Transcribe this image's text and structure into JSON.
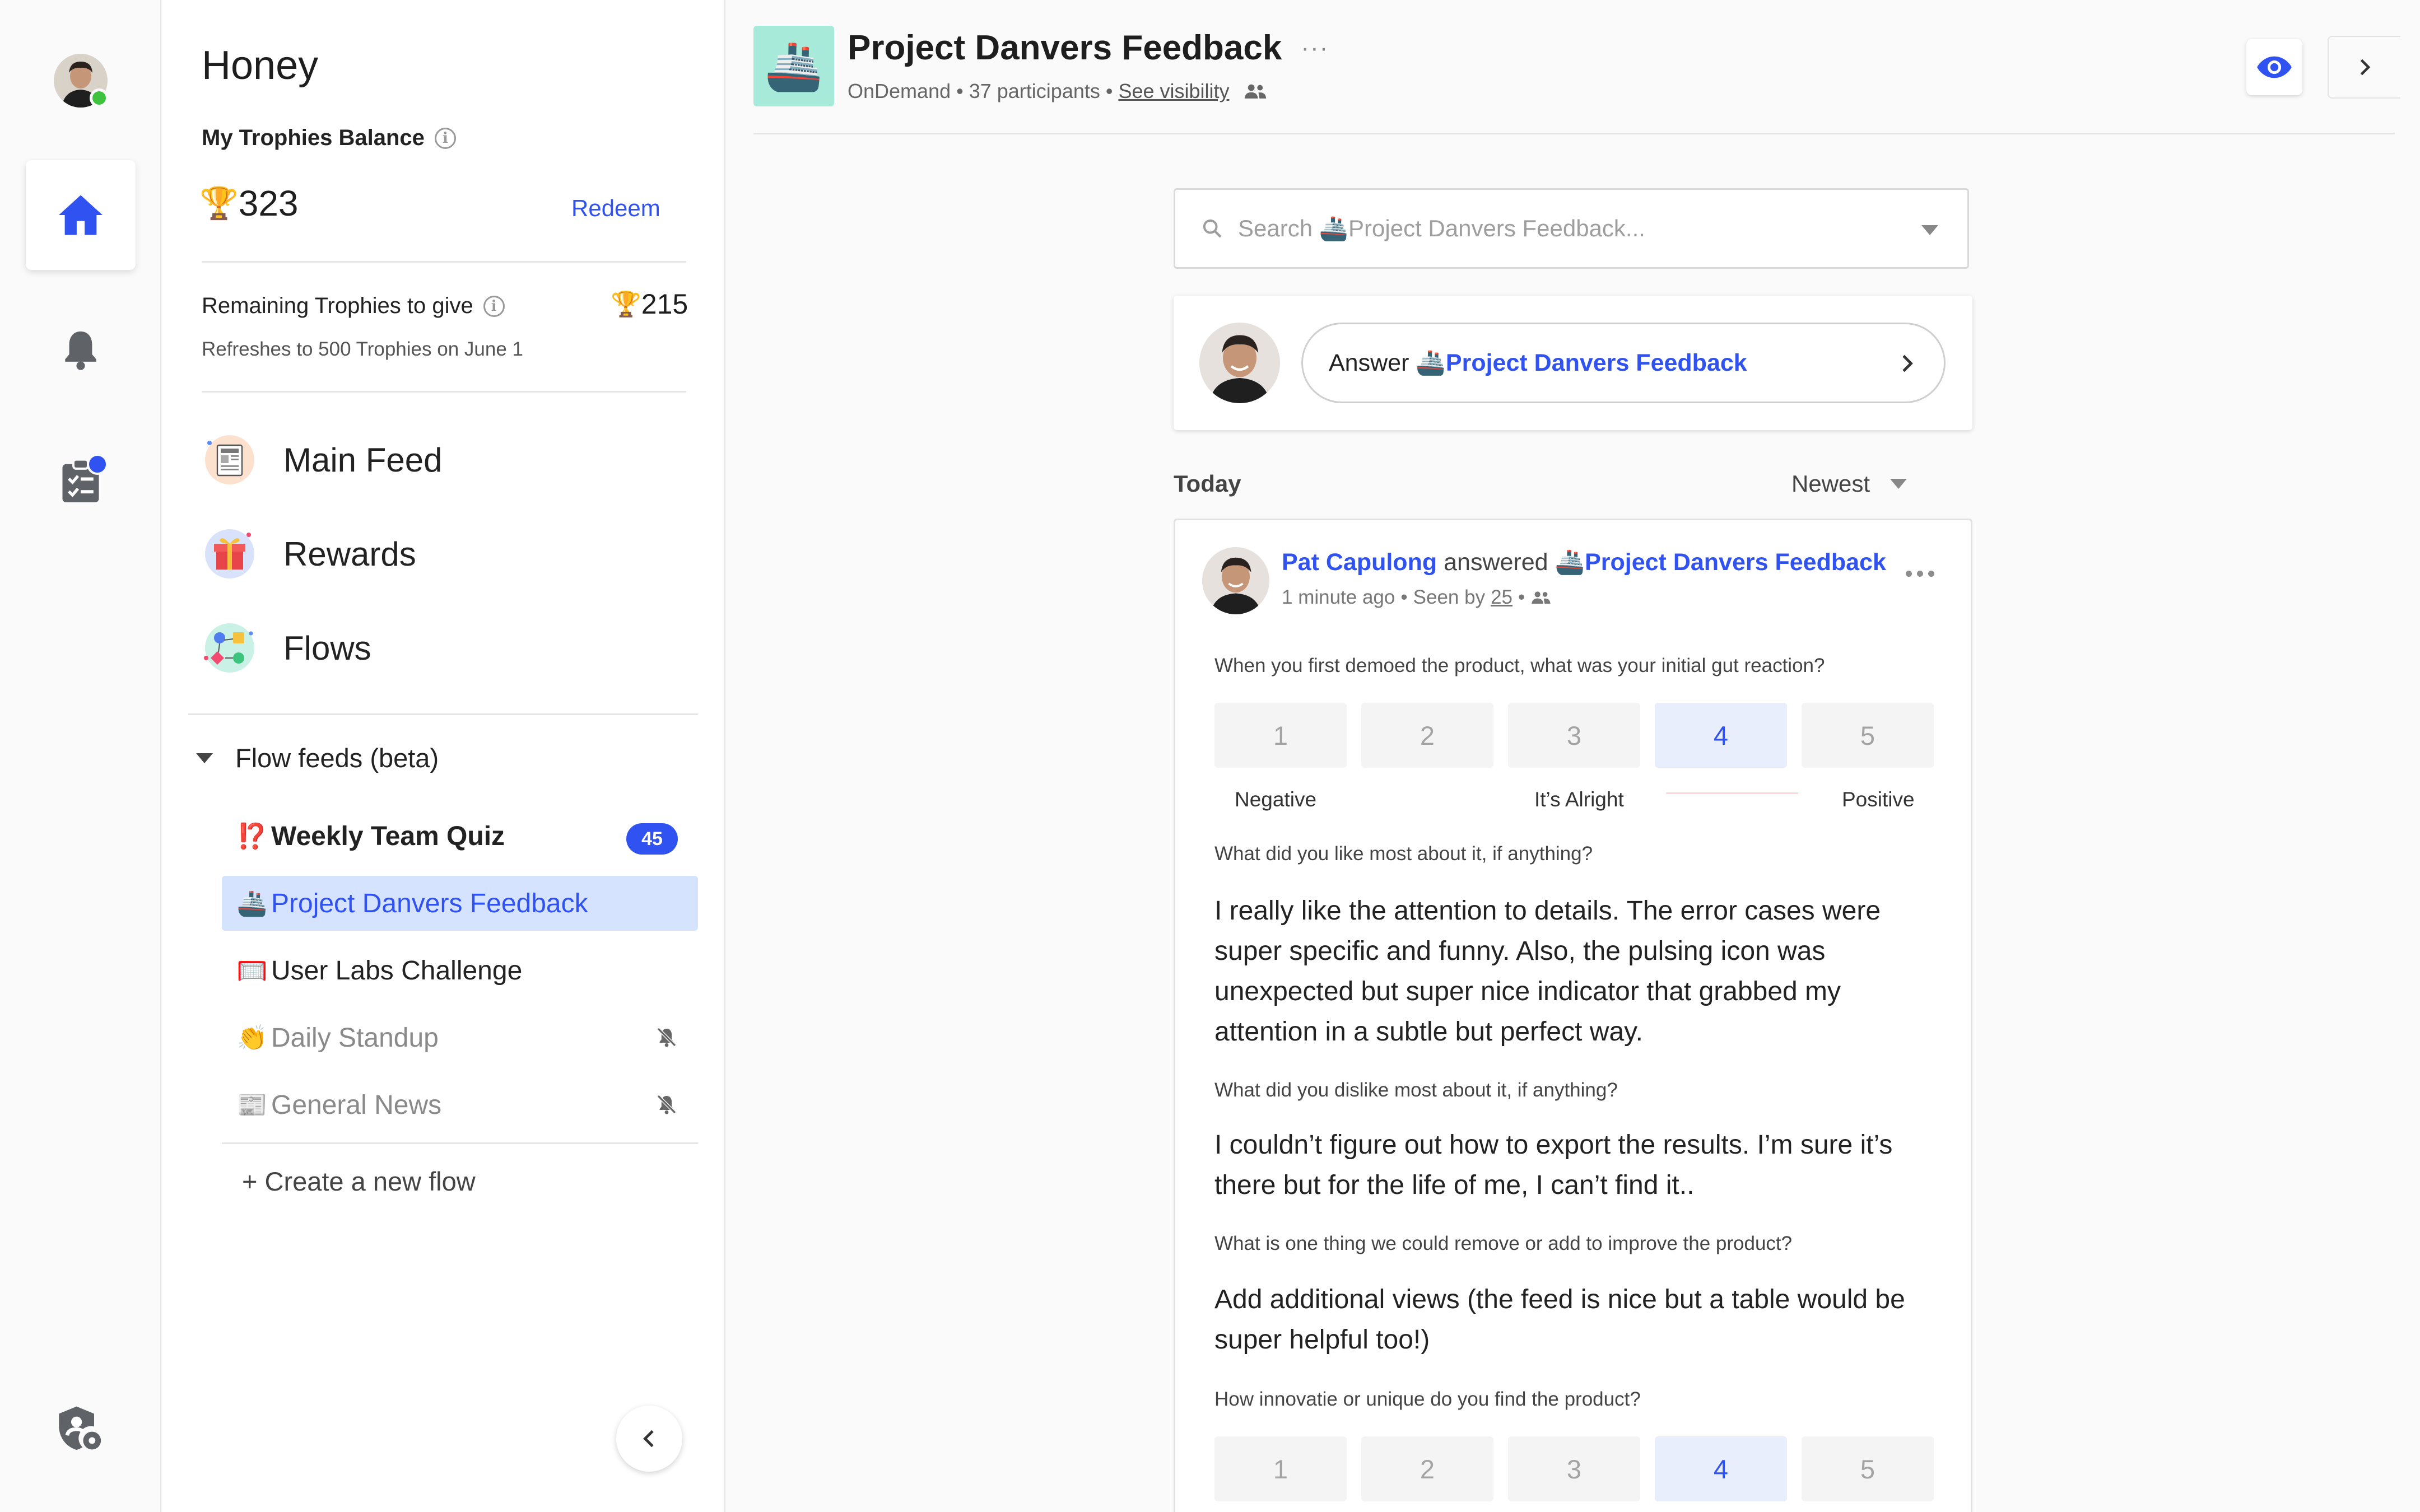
{
  "rail": {
    "items": [
      "home",
      "notifications",
      "tasks",
      "admin"
    ]
  },
  "sidebar": {
    "title": "Honey",
    "balance_label": "My Trophies Balance",
    "balance_icon": "🏆",
    "balance_value": "323",
    "redeem_label": "Redeem",
    "remaining_label": "Remaining Trophies to give",
    "remaining_value": "215",
    "refresh_note": "Refreshes to 500 Trophies on June 1",
    "nav": [
      {
        "label": "Main Feed",
        "icon": "newspaper-icon"
      },
      {
        "label": "Rewards",
        "icon": "gift-icon"
      },
      {
        "label": "Flows",
        "icon": "flows-icon"
      }
    ],
    "flow_feeds_label": "Flow feeds (beta)",
    "flows": [
      {
        "emoji": "⁉️",
        "label": "Weekly Team Quiz",
        "badge": "45",
        "state": "unread"
      },
      {
        "emoji": "🚢",
        "label": "Project Danvers Feedback",
        "state": "active"
      },
      {
        "emoji": "🥅",
        "label": "User Labs Challenge",
        "state": "normal"
      },
      {
        "emoji": "👏",
        "label": "Daily Standup",
        "state": "muted"
      },
      {
        "emoji": "📰",
        "label": "General News",
        "state": "muted"
      }
    ],
    "create_flow_label": "+ Create a new flow"
  },
  "header": {
    "emoji": "🚢",
    "title": "Project Danvers Feedback",
    "more": "···",
    "subtitle_type": "OnDemand",
    "subtitle_participants": "37 participants",
    "see_visibility": "See visibility",
    "separator": "•"
  },
  "search": {
    "placeholder": "Search 🚢Project Danvers Feedback..."
  },
  "answer_prompt": {
    "prefix": "Answer",
    "flow": "🚢Project Danvers Feedback"
  },
  "feed": {
    "section": "Today",
    "sort": "Newest"
  },
  "post": {
    "author": "Pat Capulong",
    "verb": "answered",
    "flow": "🚢Project Danvers Feedback",
    "time": "1 minute ago",
    "seen_prefix": "Seen by",
    "seen_count": "25",
    "q1": "When you first demoed the product, what was your initial gut reaction?",
    "scale1": {
      "options": [
        "1",
        "2",
        "3",
        "4",
        "5"
      ],
      "selected": "4"
    },
    "scale_labels": {
      "low": "Negative",
      "mid": "It’s Alright",
      "high": "Positive"
    },
    "q2": "What did you like most about it, if anything?",
    "a2": "I really like the attention to details. The error cases were super specific and funny. Also, the pulsing icon was unexpected but super nice indicator that grabbed my attention in a subtle but perfect way.",
    "q3": "What did you dislike most about it, if anything?",
    "a3": "I couldn’t figure out how to export the results. I’m sure it’s there but for the life of me, I can’t find it..",
    "q4": "What is one thing we could remove or add to improve the product?",
    "a4": "Add additional views (the feed is nice but a table would be super helpful too!)",
    "q5": "How innovatie or unique do you find the product?",
    "scale2": {
      "options": [
        "1",
        "2",
        "3",
        "4",
        "5"
      ],
      "selected": "4"
    }
  },
  "colors": {
    "accent": "#2f52f0",
    "active_bg": "#d6e3ff",
    "header_icon_bg": "#a8ead9",
    "presence": "#3fc33f"
  }
}
